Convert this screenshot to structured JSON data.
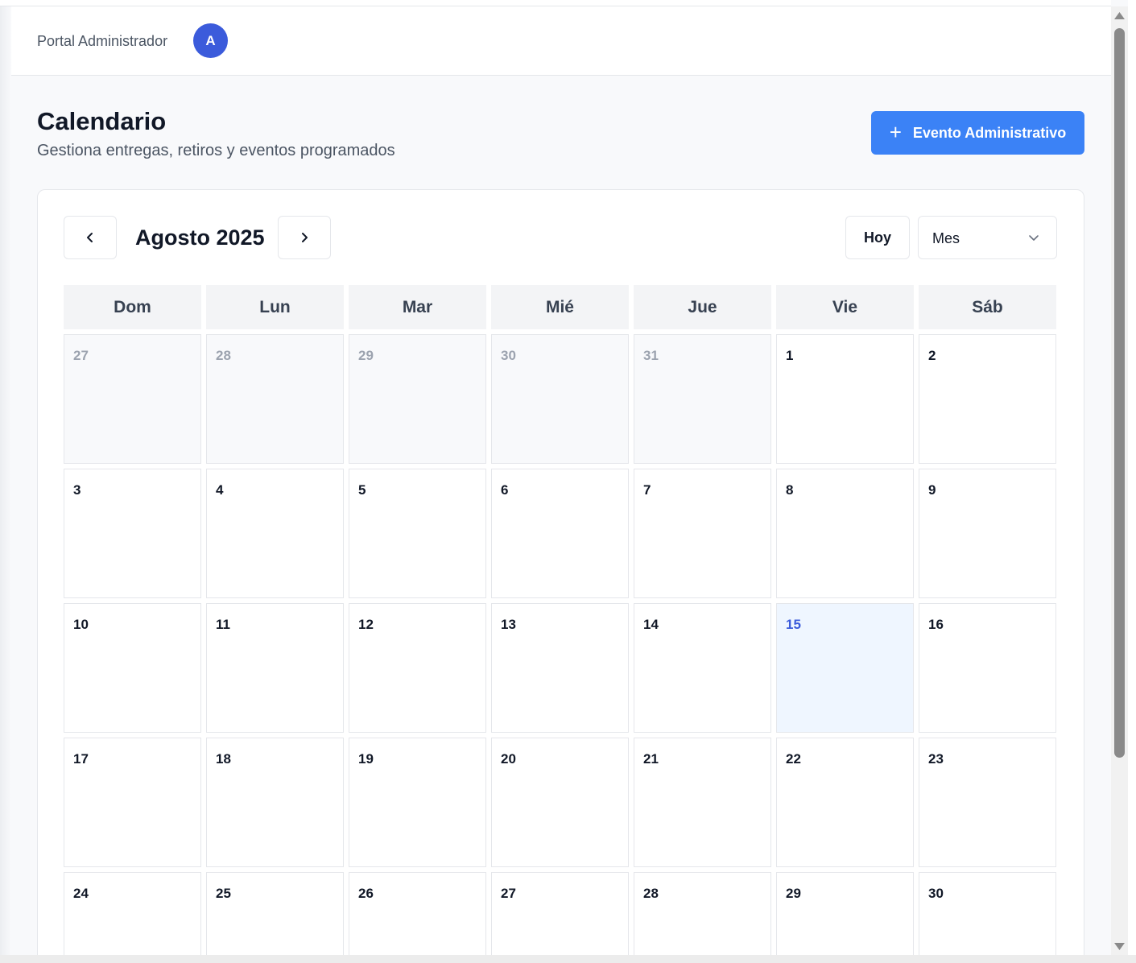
{
  "header": {
    "portal_label": "Portal Administrador",
    "avatar_initial": "A"
  },
  "page": {
    "title": "Calendario",
    "subtitle": "Gestiona entregas, retiros y eventos programados",
    "add_button_label": "Evento Administrativo",
    "add_button_icon": "plus-icon"
  },
  "calendar": {
    "month_title": "Agosto 2025",
    "prev_icon": "chevron-left-icon",
    "next_icon": "chevron-right-icon",
    "today_label": "Hoy",
    "view_select": {
      "selected": "Mes",
      "icon": "chevron-down-icon"
    },
    "weekdays": [
      "Dom",
      "Lun",
      "Mar",
      "Mié",
      "Jue",
      "Vie",
      "Sáb"
    ],
    "weeks": [
      [
        {
          "d": "27",
          "o": true
        },
        {
          "d": "28",
          "o": true
        },
        {
          "d": "29",
          "o": true
        },
        {
          "d": "30",
          "o": true
        },
        {
          "d": "31",
          "o": true
        },
        {
          "d": "1"
        },
        {
          "d": "2"
        }
      ],
      [
        {
          "d": "3"
        },
        {
          "d": "4"
        },
        {
          "d": "5"
        },
        {
          "d": "6"
        },
        {
          "d": "7"
        },
        {
          "d": "8"
        },
        {
          "d": "9"
        }
      ],
      [
        {
          "d": "10"
        },
        {
          "d": "11"
        },
        {
          "d": "12"
        },
        {
          "d": "13"
        },
        {
          "d": "14"
        },
        {
          "d": "15",
          "today": true
        },
        {
          "d": "16"
        }
      ],
      [
        {
          "d": "17"
        },
        {
          "d": "18"
        },
        {
          "d": "19"
        },
        {
          "d": "20"
        },
        {
          "d": "21"
        },
        {
          "d": "22"
        },
        {
          "d": "23"
        }
      ],
      [
        {
          "d": "24"
        },
        {
          "d": "25"
        },
        {
          "d": "26"
        },
        {
          "d": "27"
        },
        {
          "d": "28"
        },
        {
          "d": "29"
        },
        {
          "d": "30"
        }
      ]
    ]
  },
  "colors": {
    "primary": "#3b82f6",
    "avatar": "#3b5bdb",
    "today_bg": "#eff6ff"
  }
}
